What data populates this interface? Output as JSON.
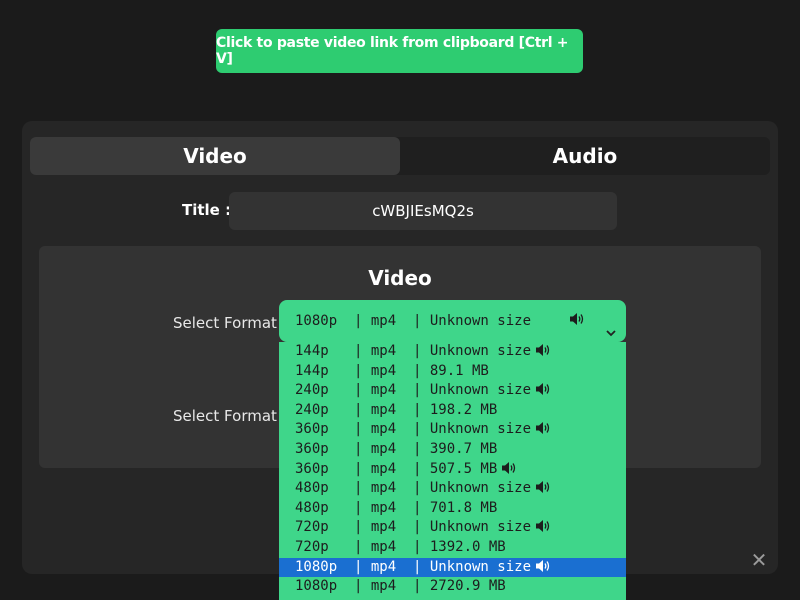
{
  "paste_button": {
    "label": "Click to paste video link from clipboard [Ctrl + V]"
  },
  "tabs": [
    {
      "label": "Video"
    },
    {
      "label": "Audio"
    }
  ],
  "title": {
    "label": "Title :",
    "value": "cWBJIEsMQ2s"
  },
  "video_section": {
    "heading": "Video",
    "select_label_1": "Select Format",
    "select_label_2": "Select Format",
    "selected_value": "1080p  | mp4  | Unknown size"
  },
  "format_options": [
    {
      "text": "144p   | mp4  | Unknown size",
      "has_audio_icon": true
    },
    {
      "text": "144p   | mp4  | 89.1 MB",
      "has_audio_icon": false
    },
    {
      "text": "240p   | mp4  | Unknown size",
      "has_audio_icon": true
    },
    {
      "text": "240p   | mp4  | 198.2 MB",
      "has_audio_icon": false
    },
    {
      "text": "360p   | mp4  | Unknown size",
      "has_audio_icon": true
    },
    {
      "text": "360p   | mp4  | 390.7 MB",
      "has_audio_icon": false
    },
    {
      "text": "360p   | mp4  | 507.5 MB",
      "has_audio_icon": true
    },
    {
      "text": "480p   | mp4  | Unknown size",
      "has_audio_icon": true
    },
    {
      "text": "480p   | mp4  | 701.8 MB",
      "has_audio_icon": false
    },
    {
      "text": "720p   | mp4  | Unknown size",
      "has_audio_icon": true
    },
    {
      "text": "720p   | mp4  | 1392.0 MB",
      "has_audio_icon": false
    },
    {
      "text": "1080p  | mp4  | Unknown size",
      "has_audio_icon": true,
      "selected": true
    },
    {
      "text": "1080p  | mp4  | 2720.9 MB",
      "has_audio_icon": false
    }
  ],
  "icons": {
    "close": "close-icon",
    "audio": "speaker-icon",
    "dropdown": "chevron-down-icon"
  },
  "colors": {
    "accent": "#2ecc71",
    "select_bg": "#3fd68a",
    "highlight": "#1a6fd1",
    "background": "#1b1b1b"
  }
}
